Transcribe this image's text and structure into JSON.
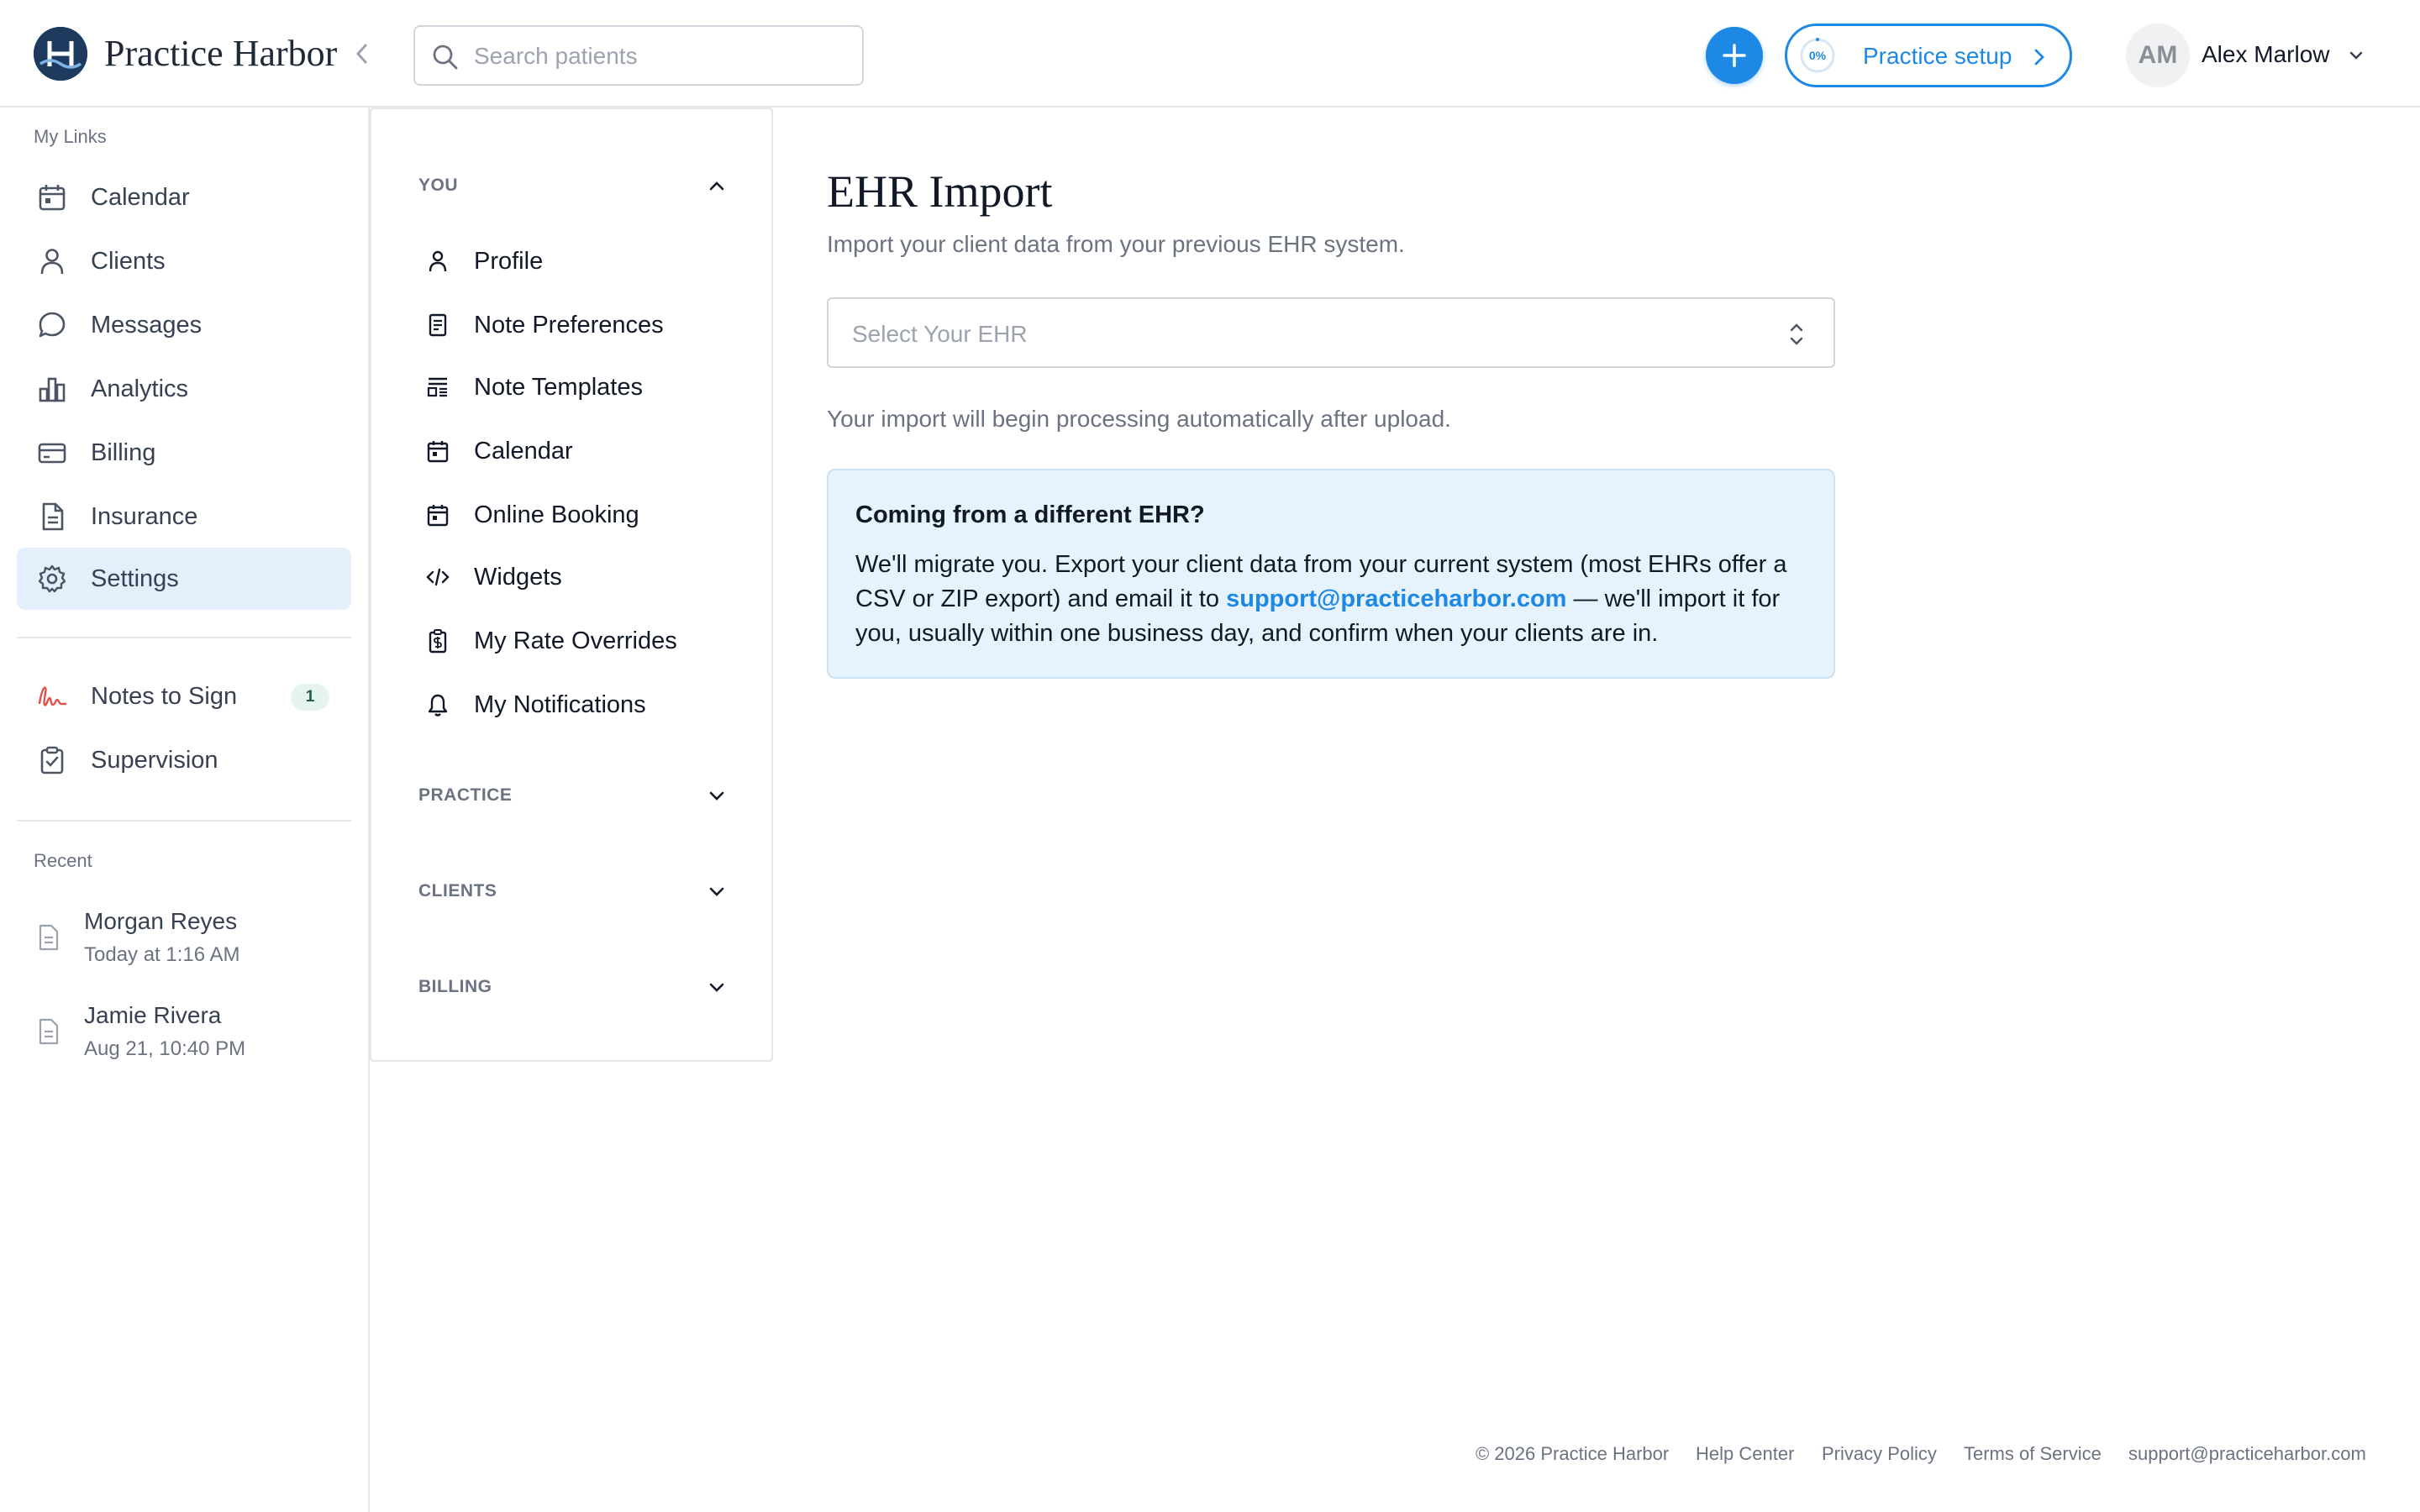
{
  "header": {
    "brand": "Practice Harbor",
    "search_placeholder": "Search patients",
    "setup_progress": "0%",
    "setup_label": "Practice setup",
    "user_initials": "AM",
    "user_name": "Alex Marlow"
  },
  "sidebar": {
    "my_links_label": "My Links",
    "items": [
      {
        "label": "Calendar",
        "icon": "calendar-icon"
      },
      {
        "label": "Clients",
        "icon": "user-icon"
      },
      {
        "label": "Messages",
        "icon": "chat-icon"
      },
      {
        "label": "Analytics",
        "icon": "bar-chart-icon"
      },
      {
        "label": "Billing",
        "icon": "credit-card-icon"
      },
      {
        "label": "Insurance",
        "icon": "document-icon"
      },
      {
        "label": "Settings",
        "icon": "gear-icon",
        "active": true
      }
    ],
    "secondary": [
      {
        "label": "Notes to Sign",
        "icon": "signature-icon",
        "badge": "1"
      },
      {
        "label": "Supervision",
        "icon": "clipboard-check-icon"
      }
    ],
    "recent_label": "Recent",
    "recent": [
      {
        "name": "Morgan Reyes",
        "time": "Today at 1:16 AM"
      },
      {
        "name": "Jamie Rivera",
        "time": "Aug 21, 10:40 PM"
      }
    ]
  },
  "settings_menu": {
    "groups": [
      {
        "label": "YOU",
        "expanded": true
      },
      {
        "label": "PRACTICE",
        "expanded": false
      },
      {
        "label": "CLIENTS",
        "expanded": false
      },
      {
        "label": "BILLING",
        "expanded": false
      }
    ],
    "you_items": [
      {
        "label": "Profile",
        "icon": "user-icon"
      },
      {
        "label": "Note Preferences",
        "icon": "note-icon"
      },
      {
        "label": "Note Templates",
        "icon": "template-icon"
      },
      {
        "label": "Calendar",
        "icon": "calendar-icon"
      },
      {
        "label": "Online Booking",
        "icon": "calendar-icon"
      },
      {
        "label": "Widgets",
        "icon": "code-icon"
      },
      {
        "label": "My Rate Overrides",
        "icon": "dollar-clipboard-icon"
      },
      {
        "label": "My Notifications",
        "icon": "bell-icon"
      }
    ]
  },
  "main": {
    "title": "EHR Import",
    "subtitle": "Import your client data from your previous EHR system.",
    "select_placeholder": "Select Your EHR",
    "processing_note": "Your import will begin processing automatically after upload.",
    "info_title": "Coming from a different EHR?",
    "info_text_before": "We'll migrate you. Export your client data from your current system (most EHRs offer a CSV or ZIP export) and email it to",
    "info_link": "support@practiceharbor.com",
    "info_text_after": "— we'll import it for you, usually within one business day, and confirm when your clients are in."
  },
  "footer": {
    "copyright": "© 2026 Practice Harbor",
    "links": [
      "Help Center",
      "Privacy Policy",
      "Terms of Service",
      "support@practiceharbor.com"
    ]
  },
  "colors": {
    "accent": "#1e88e5",
    "active_nav_bg": "#e3f0fb",
    "info_bg": "#e7f3fc",
    "brand_navy": "#1e3a5f",
    "signature_red": "#e0524b"
  }
}
